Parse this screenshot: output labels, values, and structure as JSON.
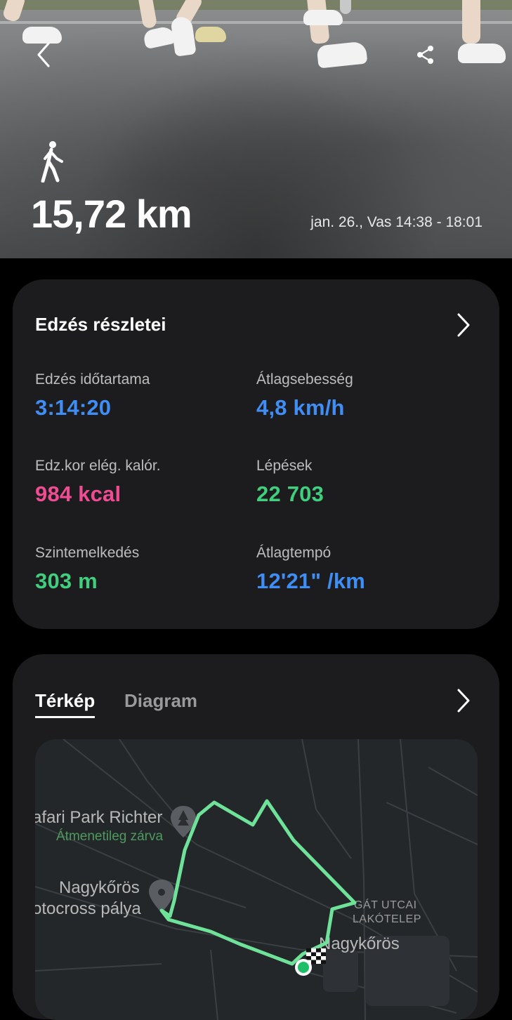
{
  "header": {
    "distance": "15,72 km",
    "datetime": "jan. 26., Vas 14:38 - 18:01"
  },
  "workout_details": {
    "title": "Edzés részletei",
    "stats": [
      {
        "label": "Edzés időtartama",
        "value": "3:14:20",
        "color": "#3f8ef5"
      },
      {
        "label": "Átlagsebesség",
        "value": "4,8 km/h",
        "color": "#3f8ef5"
      },
      {
        "label": "Edz.kor elég. kalór.",
        "value": "984 kcal",
        "color": "#ef4c93"
      },
      {
        "label": "Lépések",
        "value": "22 703",
        "color": "#3fcf7e"
      },
      {
        "label": "Szintemelkedés",
        "value": "303 m",
        "color": "#3fcf7e"
      },
      {
        "label": "Átlagtempó",
        "value": "12'21\" /km",
        "color": "#3f8ef5"
      }
    ]
  },
  "map_card": {
    "tabs": [
      "Térkép",
      "Diagram"
    ],
    "active_tab": "Térkép",
    "map_labels": {
      "park_name": "afari Park Richter",
      "park_status": "Átmenetileg zárva",
      "track_line1": "Nagykőrös",
      "track_line2": "otocross pálya",
      "estate_line1": "GÁT UTCAI",
      "estate_line2": "LAKÓTELEP",
      "town": "Nagykőrös"
    }
  },
  "icons": {
    "back": "chevron-left-icon",
    "share": "share-icon",
    "walk": "walking-person-icon",
    "more": "chevron-right-icon",
    "park_pin": "tree-pin-icon",
    "track_pin": "location-pin-icon",
    "start": "start-point-icon",
    "finish": "finish-flag-icon"
  },
  "colors": {
    "route": "#6fe29a",
    "blue_value": "#3f8ef5",
    "pink_value": "#ef4c93",
    "green_value": "#3fcf7e",
    "card_bg": "#1c1c1e"
  }
}
